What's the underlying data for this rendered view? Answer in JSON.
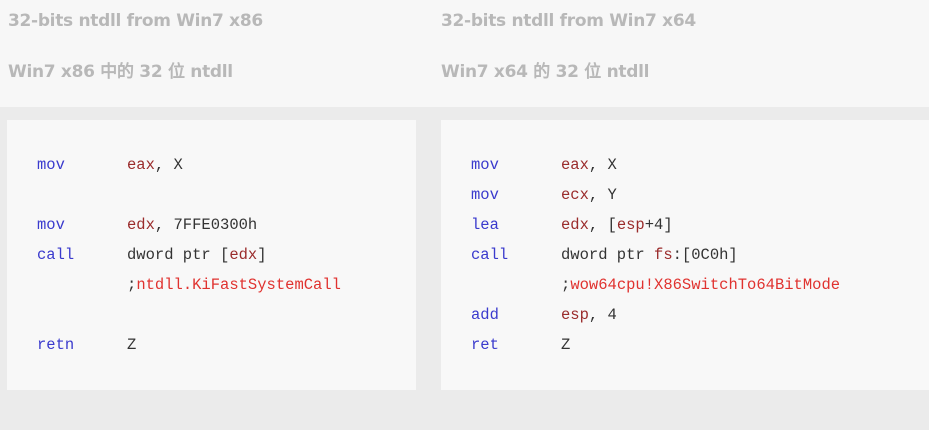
{
  "left": {
    "title_en": "32-bits ntdll from Win7 x86",
    "title_cn": "Win7 x86 中的 32 位 ntdll",
    "code": {
      "l1_op": "mov",
      "l1_reg": "eax",
      "l1_rest": ", X",
      "l2_op": "mov",
      "l2_reg": "edx",
      "l2_rest": ", 7FFE0300h",
      "l3_op": "call",
      "l3_a": "dword ptr [",
      "l3_reg": "edx",
      "l3_b": "]",
      "l4_semi": ";",
      "l4_cmt": "ntdll.KiFastSystemCall",
      "l5_op": "retn",
      "l5_rest": "Z"
    }
  },
  "right": {
    "title_en": "32-bits ntdll from Win7 x64",
    "title_cn": "Win7 x64 的 32 位 ntdll",
    "code": {
      "l1_op": "mov",
      "l1_reg": "eax",
      "l1_rest": ", X",
      "l2_op": "mov",
      "l2_reg": "ecx",
      "l2_rest": ", Y",
      "l3_op": "lea",
      "l3_reg": "edx",
      "l3_a": ", [",
      "l3_reg2": "esp",
      "l3_b": "+4]",
      "l4_op": "call",
      "l4_a": "dword ptr ",
      "l4_reg": "fs",
      "l4_b": ":[0C0h]",
      "l5_semi": ";",
      "l5_cmt": "wow64cpu!X86SwitchTo64BitMode",
      "l6_op": "add",
      "l6_reg": "esp",
      "l6_rest": ", 4",
      "l7_op": "ret",
      "l7_rest": "Z"
    }
  }
}
